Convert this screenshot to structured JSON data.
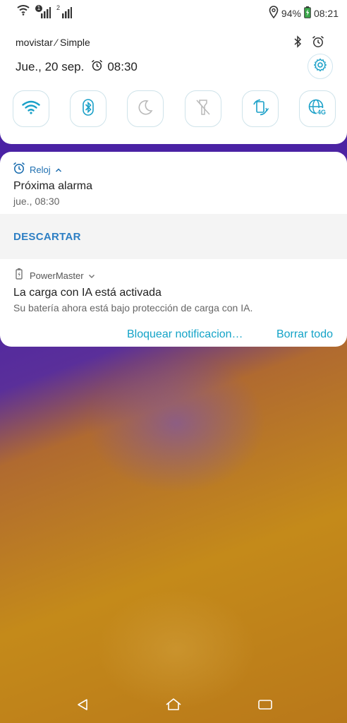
{
  "status_bar": {
    "sim1_label": "1",
    "sim2_label": "2",
    "battery": "94%",
    "time": "08:21"
  },
  "quick_settings": {
    "carrier": "movistar ∕ Simple",
    "date": "Jue., 20 sep.",
    "alarm_time": "08:30",
    "tiles": [
      "wifi-icon",
      "bluetooth-icon",
      "do-not-disturb-moon-icon",
      "flashlight-off-icon",
      "auto-rotate-icon",
      "mobile-data-4g-icon"
    ]
  },
  "notifications": {
    "clock": {
      "app_name": "Reloj",
      "title": "Próxima alarma",
      "text": "jue., 08:30",
      "action": "DESCARTAR"
    },
    "powermaster": {
      "app_name": "PowerMaster",
      "title": "La carga con IA está activada",
      "text": "Su batería ahora está bajo protección de carga con IA."
    },
    "footer": {
      "block": "Bloquear notificacion…",
      "clear_all": "Borrar todo"
    }
  },
  "colors": {
    "accent_blue": "#2d7fc4",
    "footer_cyan": "#14a3c7",
    "tile_icon": "#1aa0c8"
  }
}
